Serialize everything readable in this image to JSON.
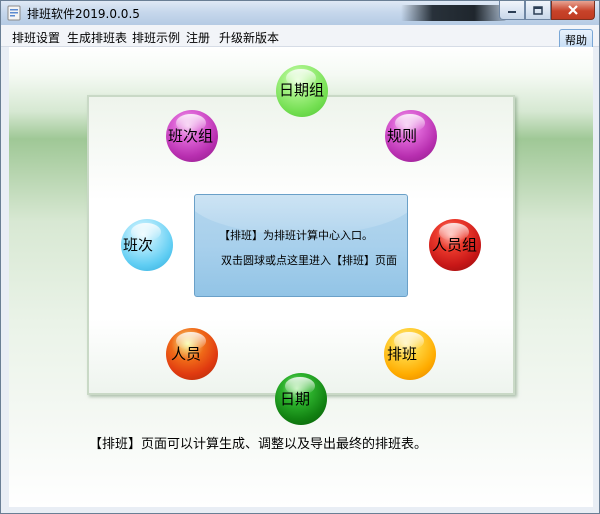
{
  "window": {
    "title": "排班软件2019.0.0.5"
  },
  "menu": {
    "items": [
      "排班设置",
      "生成排班表",
      "排班示例",
      "注册",
      "升级新版本"
    ],
    "help_label": "帮助"
  },
  "center_panel": {
    "line1": "【排班】为排班计算中心入口。",
    "line2": "双击圆球或点这里进入【排班】页面"
  },
  "spheres": [
    {
      "label": "日期组",
      "color": "#7ee25c"
    },
    {
      "label": "规则",
      "color": "#c03bbb"
    },
    {
      "label": "人员组",
      "color": "#d01a1a"
    },
    {
      "label": "排班",
      "color": "#ffb400"
    },
    {
      "label": "日期",
      "color": "#138a13"
    },
    {
      "label": "人员",
      "color": "#e83a18"
    },
    {
      "label": "班次",
      "color": "#5fcdf3"
    },
    {
      "label": "班次组",
      "color": "#c23abd"
    }
  ],
  "footer_text": "【排班】页面可以计算生成、调整以及导出最终的排班表。"
}
